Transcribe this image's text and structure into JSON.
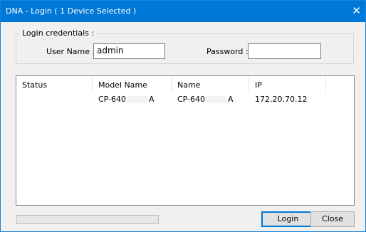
{
  "window": {
    "title": "DNA - Login ( 1 Device Selected )",
    "close_glyph": "✕"
  },
  "credentials": {
    "legend": "Login credentials :",
    "username_label": "User Name :",
    "username_value": "admin",
    "password_label": "Password :",
    "password_value": ""
  },
  "table": {
    "columns": [
      "Status",
      "Model Name",
      "Name",
      "IP"
    ],
    "rows": [
      {
        "status": "",
        "model_prefix": "CP-640",
        "model_suffix": "A",
        "name_prefix": "CP-640",
        "name_suffix": "A",
        "ip": "172.20.70.12"
      }
    ]
  },
  "progress": {
    "fraction": 0
  },
  "buttons": {
    "login": "Login",
    "close": "Close"
  }
}
